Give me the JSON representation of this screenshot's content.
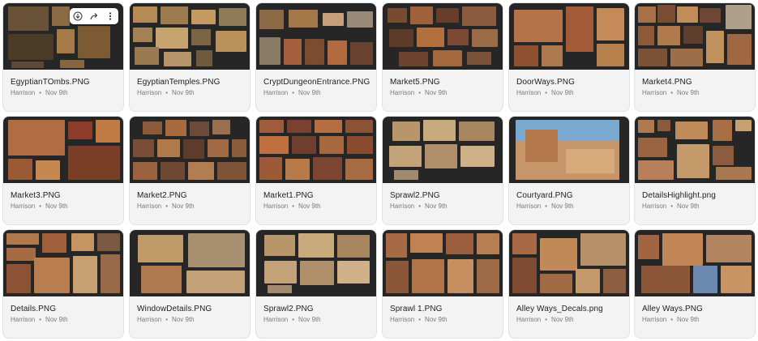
{
  "card_meta_separator": "•",
  "card_toolbar": {
    "download_icon": "download-icon",
    "share_icon": "share-icon",
    "more_icon": "more-vertical-icon"
  },
  "cards": [
    {
      "title": "EgyptianTOmbs.PNG",
      "author": "Harrison",
      "date": "Nov 9th"
    },
    {
      "title": "EgyptianTemples.PNG",
      "author": "Harrison",
      "date": "Nov 9th"
    },
    {
      "title": "CryptDungeonEntrance.PNG",
      "author": "Harrison",
      "date": "Nov 9th"
    },
    {
      "title": "Market5.PNG",
      "author": "Harrison",
      "date": "Nov 9th"
    },
    {
      "title": "DoorWays.PNG",
      "author": "Harrison",
      "date": "Nov 9th"
    },
    {
      "title": "Market4.PNG",
      "author": "Harrison",
      "date": "Nov 9th"
    },
    {
      "title": "Market3.PNG",
      "author": "Harrison",
      "date": "Nov 9th"
    },
    {
      "title": "Market2.PNG",
      "author": "Harrison",
      "date": "Nov 9th"
    },
    {
      "title": "Market1.PNG",
      "author": "Harrison",
      "date": "Nov 9th"
    },
    {
      "title": "Sprawl2.PNG",
      "author": "Harrison",
      "date": "Nov 9th"
    },
    {
      "title": "Courtyard.PNG",
      "author": "Harrison",
      "date": "Nov 9th"
    },
    {
      "title": "DetailsHighlight.png",
      "author": "Harrison",
      "date": "Nov 9th"
    },
    {
      "title": "Details.PNG",
      "author": "Harrison",
      "date": "Nov 9th"
    },
    {
      "title": "WindowDetails.PNG",
      "author": "Harrison",
      "date": "Nov 9th"
    },
    {
      "title": "Sprawl2.PNG",
      "author": "Harrison",
      "date": "Nov 9th"
    },
    {
      "title": "Sprawl 1.PNG",
      "author": "Harrison",
      "date": "Nov 9th"
    },
    {
      "title": "Alley Ways_Decals.png",
      "author": "Harrison",
      "date": "Nov 9th"
    },
    {
      "title": "Alley Ways.PNG",
      "author": "Harrison",
      "date": "Nov 9th"
    }
  ]
}
